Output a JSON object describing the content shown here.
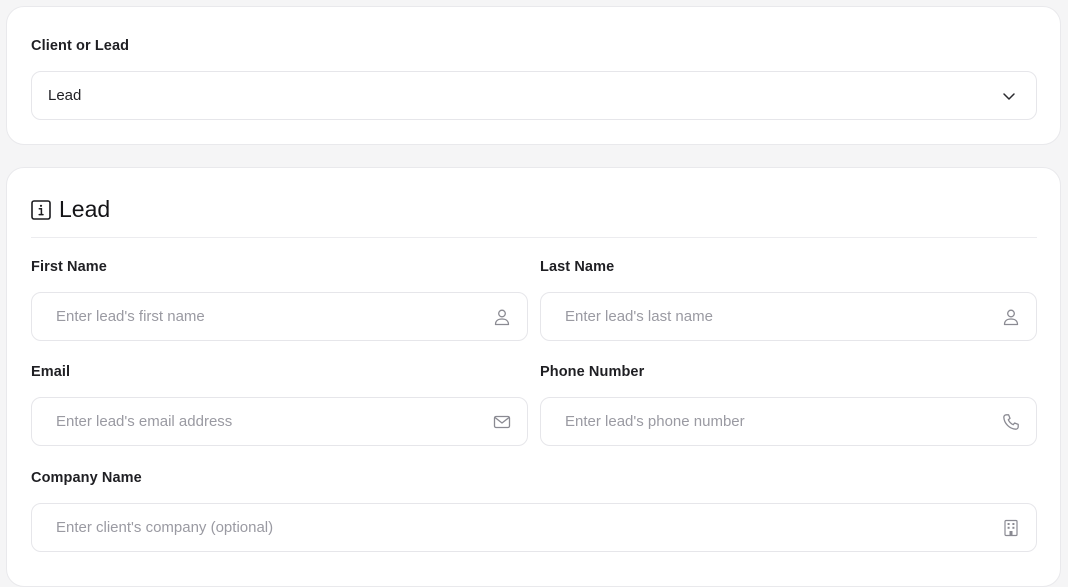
{
  "client_or_lead": {
    "label": "Client or Lead",
    "selected": "Lead"
  },
  "lead_section": {
    "title": "Lead",
    "first_name": {
      "label": "First Name",
      "placeholder": "Enter lead's first name"
    },
    "last_name": {
      "label": "Last Name",
      "placeholder": "Enter lead's last name"
    },
    "email": {
      "label": "Email",
      "placeholder": "Enter lead's email address"
    },
    "phone": {
      "label": "Phone Number",
      "placeholder": "Enter lead's phone number"
    },
    "company": {
      "label": "Company Name",
      "placeholder": "Enter client's company (optional)"
    }
  },
  "icons": {
    "select": "chevron-down-icon",
    "section": "info-icon",
    "first_name": "user-icon",
    "last_name": "user-icon",
    "email": "mail-icon",
    "phone": "phone-icon",
    "company": "building-icon"
  },
  "colors": {
    "background": "#f5f5f6",
    "card": "#ffffff",
    "border": "#e6e6ea",
    "placeholder": "#9a9aa2",
    "icon": "#8a8a92"
  }
}
